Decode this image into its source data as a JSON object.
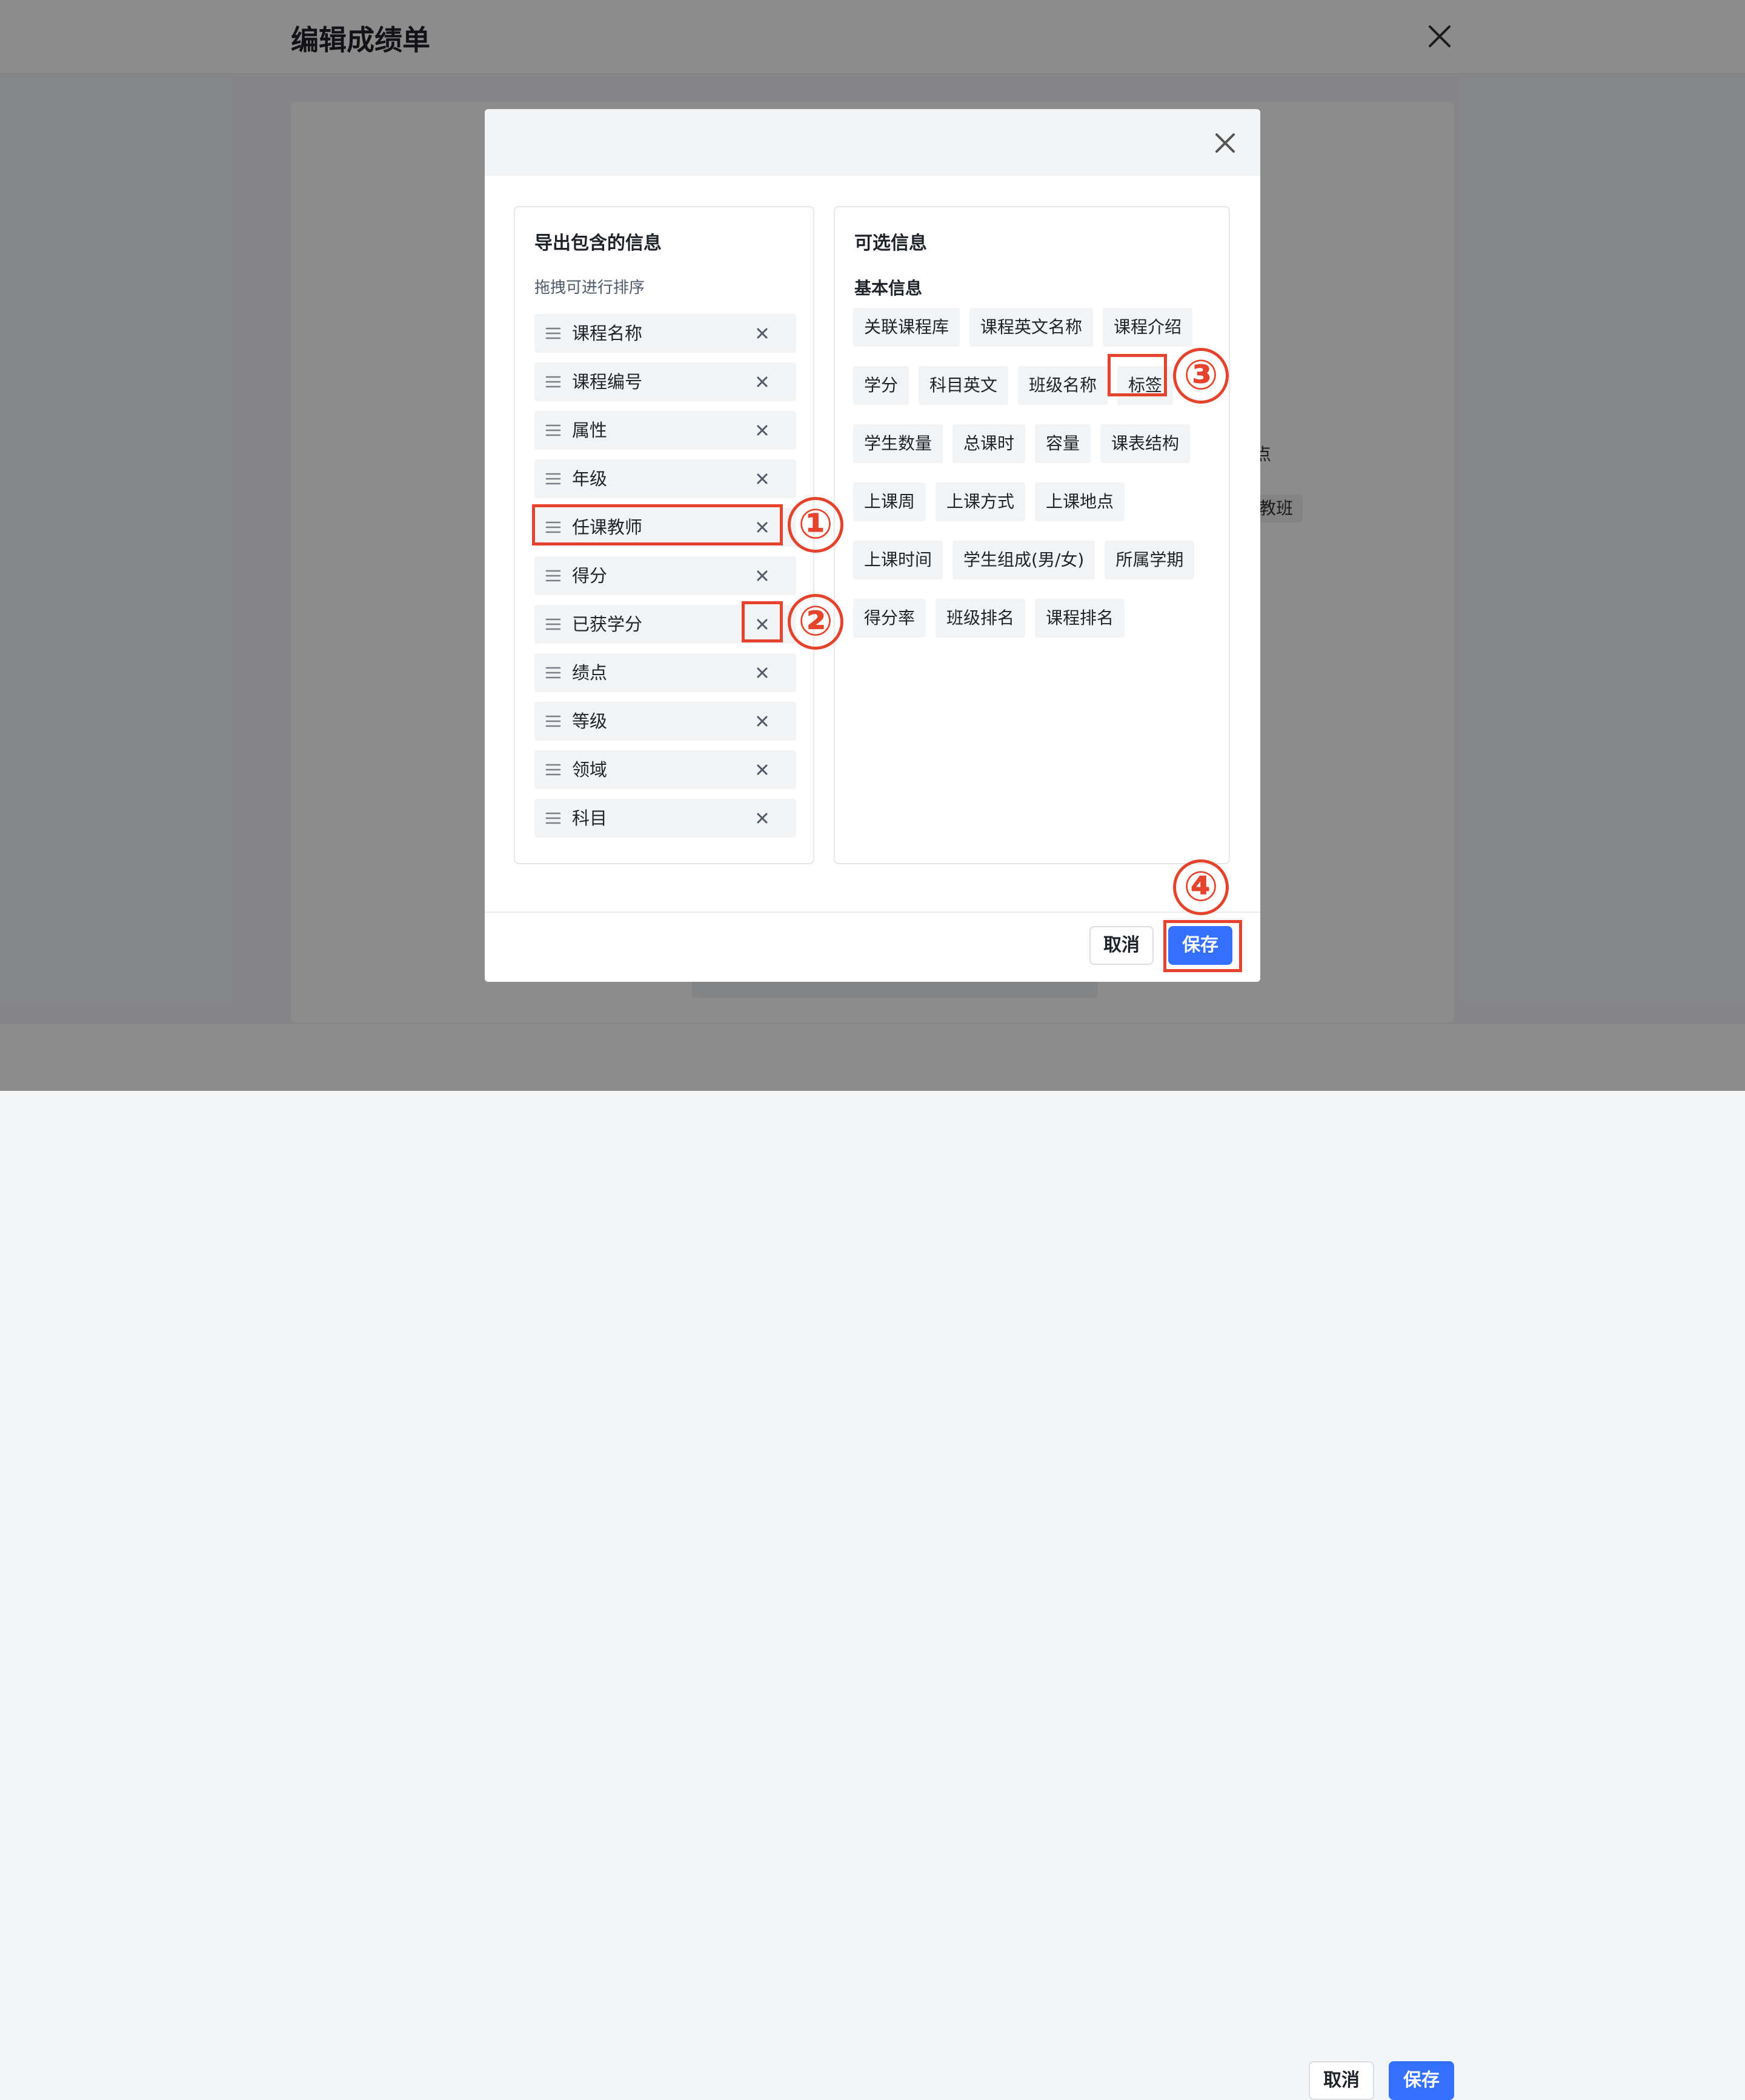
{
  "page": {
    "title": "编辑成绩单",
    "bg_fragment_1": "点",
    "bg_fragment_2": "教班",
    "footer": {
      "cancel_label": "取消",
      "save_label": "保存"
    }
  },
  "dialog": {
    "left_panel": {
      "title": "导出包含的信息",
      "subtitle": "拖拽可进行排序",
      "items": [
        {
          "label": "课程名称"
        },
        {
          "label": "课程编号"
        },
        {
          "label": "属性"
        },
        {
          "label": "年级"
        },
        {
          "label": "任课教师"
        },
        {
          "label": "得分"
        },
        {
          "label": "已获学分"
        },
        {
          "label": "绩点"
        },
        {
          "label": "等级"
        },
        {
          "label": "领域"
        },
        {
          "label": "科目"
        }
      ]
    },
    "right_panel": {
      "title": "可选信息",
      "group_title": "基本信息",
      "tags": [
        [
          "关联课程库",
          "课程英文名称",
          "课程介绍"
        ],
        [
          "学分",
          "科目英文",
          "班级名称",
          "标签"
        ],
        [
          "学生数量",
          "总课时",
          "容量",
          "课表结构"
        ],
        [
          "上课周",
          "上课方式",
          "上课地点"
        ],
        [
          "上课时间",
          "学生组成(男/女)",
          "所属学期"
        ],
        [
          "得分率",
          "班级排名",
          "课程排名"
        ]
      ]
    },
    "footer": {
      "cancel_label": "取消",
      "save_label": "保存"
    }
  },
  "annotations": [
    "①",
    "②",
    "③",
    "④"
  ],
  "colors": {
    "primary": "#3370ff",
    "annotation": "#e5432b",
    "tag_bg": "#f2f3f5"
  }
}
